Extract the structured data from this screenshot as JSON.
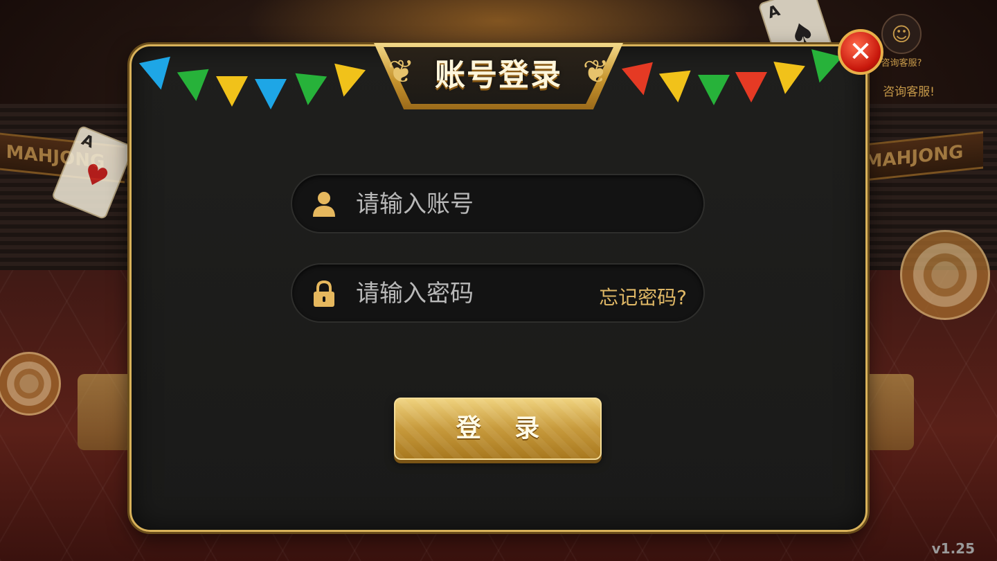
{
  "dialog": {
    "title": "账号登录",
    "close_icon": "close-icon",
    "username_placeholder": "请输入账号",
    "password_placeholder": "请输入密码",
    "forgot_label": "忘记密码?",
    "login_label": "登 录",
    "user_icon": "person-icon",
    "lock_icon": "lock-icon"
  },
  "background": {
    "banner_left": "MAHJONG",
    "banner_right": "MAHJONG",
    "card_left_rank": "A",
    "card_left_suit": "♥",
    "card_right_rank": "A",
    "card_right_suit": "♠"
  },
  "service": {
    "bubble_text": "咨询客服?",
    "text": "咨询客服!",
    "avatar_icon": "headset-icon"
  },
  "version": "v1.25",
  "colors": {
    "accent_gold": "#d9b25a",
    "close_red": "#c8180c",
    "panel": "#1f1f1d"
  }
}
